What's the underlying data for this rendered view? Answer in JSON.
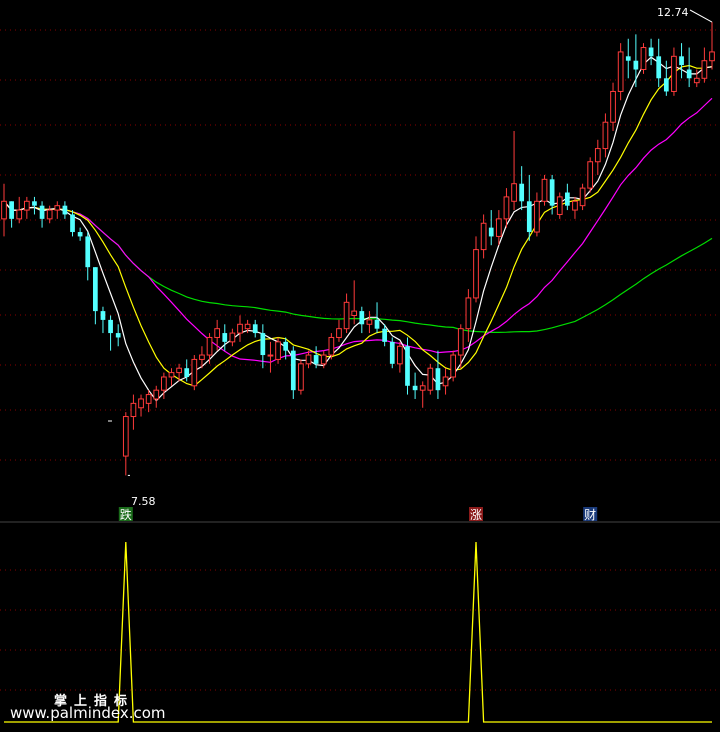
{
  "chart_data": [
    {
      "type": "candlestick",
      "title": "",
      "price_labels": {
        "high_label": "12.74",
        "low_label": "7.58"
      },
      "y_range": [
        7.3,
        12.9
      ],
      "colors": {
        "up": "#ff3b3b",
        "down": "#54ffff",
        "ma5": "#ffffff",
        "ma10": "#ffff00",
        "ma20": "#ff00ff",
        "ma60": "#00dd00"
      },
      "candles": [
        [
          10.5,
          10.9,
          10.3,
          10.7
        ],
        [
          10.7,
          10.7,
          10.4,
          10.5
        ],
        [
          10.5,
          10.75,
          10.45,
          10.6
        ],
        [
          10.6,
          10.75,
          10.5,
          10.7
        ],
        [
          10.7,
          10.75,
          10.55,
          10.65
        ],
        [
          10.65,
          10.7,
          10.4,
          10.5
        ],
        [
          10.5,
          10.65,
          10.45,
          10.6
        ],
        [
          10.6,
          10.7,
          10.5,
          10.65
        ],
        [
          10.65,
          10.7,
          10.5,
          10.55
        ],
        [
          10.55,
          10.6,
          10.3,
          10.35
        ],
        [
          10.35,
          10.4,
          10.25,
          10.3
        ],
        [
          10.3,
          10.35,
          9.8,
          9.95
        ],
        [
          9.95,
          9.95,
          9.3,
          9.45
        ],
        [
          9.45,
          9.5,
          9.2,
          9.35
        ],
        [
          9.35,
          9.4,
          9.0,
          9.2
        ],
        [
          9.2,
          9.3,
          9.05,
          9.15
        ],
        [
          7.8,
          8.3,
          7.58,
          8.25
        ],
        [
          8.25,
          8.5,
          8.1,
          8.4
        ],
        [
          8.35,
          8.5,
          8.25,
          8.45
        ],
        [
          8.4,
          8.55,
          8.3,
          8.5
        ],
        [
          8.45,
          8.6,
          8.35,
          8.55
        ],
        [
          8.55,
          8.75,
          8.45,
          8.7
        ],
        [
          8.7,
          8.8,
          8.6,
          8.75
        ],
        [
          8.75,
          8.85,
          8.65,
          8.8
        ],
        [
          8.8,
          8.9,
          8.65,
          8.7
        ],
        [
          8.6,
          8.95,
          8.55,
          8.9
        ],
        [
          8.9,
          9.05,
          8.8,
          8.95
        ],
        [
          8.95,
          9.2,
          8.85,
          9.15
        ],
        [
          9.15,
          9.35,
          9.0,
          9.25
        ],
        [
          9.2,
          9.3,
          9.0,
          9.1
        ],
        [
          9.1,
          9.25,
          9.05,
          9.2
        ],
        [
          9.2,
          9.4,
          9.1,
          9.3
        ],
        [
          9.25,
          9.35,
          9.2,
          9.3
        ],
        [
          9.3,
          9.35,
          9.15,
          9.2
        ],
        [
          9.2,
          9.3,
          8.8,
          8.95
        ],
        [
          8.95,
          9.1,
          8.75,
          8.95
        ],
        [
          8.9,
          9.15,
          8.85,
          9.1
        ],
        [
          9.1,
          9.15,
          8.9,
          9.0
        ],
        [
          9.0,
          9.05,
          8.45,
          8.55
        ],
        [
          8.55,
          8.9,
          8.5,
          8.85
        ],
        [
          8.85,
          9.0,
          8.8,
          8.95
        ],
        [
          8.95,
          9.05,
          8.8,
          8.85
        ],
        [
          8.85,
          9.0,
          8.8,
          8.95
        ],
        [
          8.95,
          9.2,
          8.9,
          9.15
        ],
        [
          9.15,
          9.35,
          9.1,
          9.25
        ],
        [
          9.25,
          9.65,
          9.2,
          9.55
        ],
        [
          9.4,
          9.8,
          9.3,
          9.45
        ],
        [
          9.45,
          9.5,
          9.2,
          9.3
        ],
        [
          9.3,
          9.45,
          9.2,
          9.35
        ],
        [
          9.35,
          9.55,
          9.2,
          9.25
        ],
        [
          9.25,
          9.3,
          9.05,
          9.1
        ],
        [
          9.1,
          9.15,
          8.8,
          8.85
        ],
        [
          8.85,
          9.1,
          8.75,
          9.05
        ],
        [
          9.05,
          9.15,
          8.5,
          8.6
        ],
        [
          8.6,
          8.75,
          8.45,
          8.55
        ],
        [
          8.55,
          8.65,
          8.35,
          8.6
        ],
        [
          8.55,
          8.85,
          8.5,
          8.8
        ],
        [
          8.8,
          9.0,
          8.45,
          8.55
        ],
        [
          8.6,
          8.8,
          8.5,
          8.7
        ],
        [
          8.7,
          9.0,
          8.65,
          8.95
        ],
        [
          8.95,
          9.3,
          8.8,
          9.25
        ],
        [
          9.25,
          9.7,
          9.1,
          9.6
        ],
        [
          9.6,
          10.3,
          9.55,
          10.15
        ],
        [
          10.15,
          10.55,
          10.05,
          10.45
        ],
        [
          10.4,
          10.6,
          10.2,
          10.3
        ],
        [
          10.3,
          10.6,
          10.2,
          10.5
        ],
        [
          10.5,
          10.85,
          10.4,
          10.75
        ],
        [
          10.7,
          11.5,
          10.6,
          10.9
        ],
        [
          10.9,
          11.1,
          10.6,
          10.7
        ],
        [
          10.7,
          11.0,
          10.25,
          10.35
        ],
        [
          10.35,
          10.8,
          10.3,
          10.7
        ],
        [
          10.7,
          11.0,
          10.65,
          10.95
        ],
        [
          10.95,
          11.0,
          10.55,
          10.65
        ],
        [
          10.55,
          10.8,
          10.5,
          10.75
        ],
        [
          10.8,
          10.9,
          10.6,
          10.65
        ],
        [
          10.6,
          10.75,
          10.5,
          10.7
        ],
        [
          10.65,
          10.9,
          10.6,
          10.85
        ],
        [
          10.85,
          11.2,
          10.8,
          11.15
        ],
        [
          11.15,
          11.4,
          11.0,
          11.3
        ],
        [
          11.3,
          11.7,
          11.2,
          11.6
        ],
        [
          11.6,
          12.05,
          11.5,
          11.95
        ],
        [
          11.95,
          12.5,
          11.85,
          12.4
        ],
        [
          12.35,
          12.55,
          12.1,
          12.3
        ],
        [
          12.3,
          12.6,
          12.0,
          12.2
        ],
        [
          12.2,
          12.5,
          12.15,
          12.45
        ],
        [
          12.45,
          12.55,
          12.25,
          12.35
        ],
        [
          12.35,
          12.55,
          12.0,
          12.1
        ],
        [
          12.1,
          12.3,
          11.9,
          11.95
        ],
        [
          11.95,
          12.45,
          11.9,
          12.35
        ],
        [
          12.35,
          12.5,
          12.1,
          12.25
        ],
        [
          12.2,
          12.45,
          12.0,
          12.1
        ],
        [
          12.05,
          12.2,
          12.0,
          12.1
        ],
        [
          12.1,
          12.45,
          12.05,
          12.3
        ],
        [
          12.3,
          12.74,
          12.2,
          12.4
        ]
      ]
    },
    {
      "type": "line",
      "title": "",
      "y_range": [
        0,
        1
      ],
      "color": "#ffff00",
      "spikes_at": [
        16,
        62
      ],
      "signals": [
        {
          "index": 16,
          "label": "跌",
          "color": "#ffffff",
          "bg": "#1a6b1a"
        },
        {
          "index": 62,
          "label": "涨",
          "color": "#ffffff",
          "bg": "#8b1a1a"
        },
        {
          "index": 77,
          "label": "财",
          "color": "#ffffff",
          "bg": "#1a3a7a"
        }
      ]
    }
  ],
  "watermark": {
    "cn": "掌上指标",
    "url": "www.palmindex.com"
  }
}
